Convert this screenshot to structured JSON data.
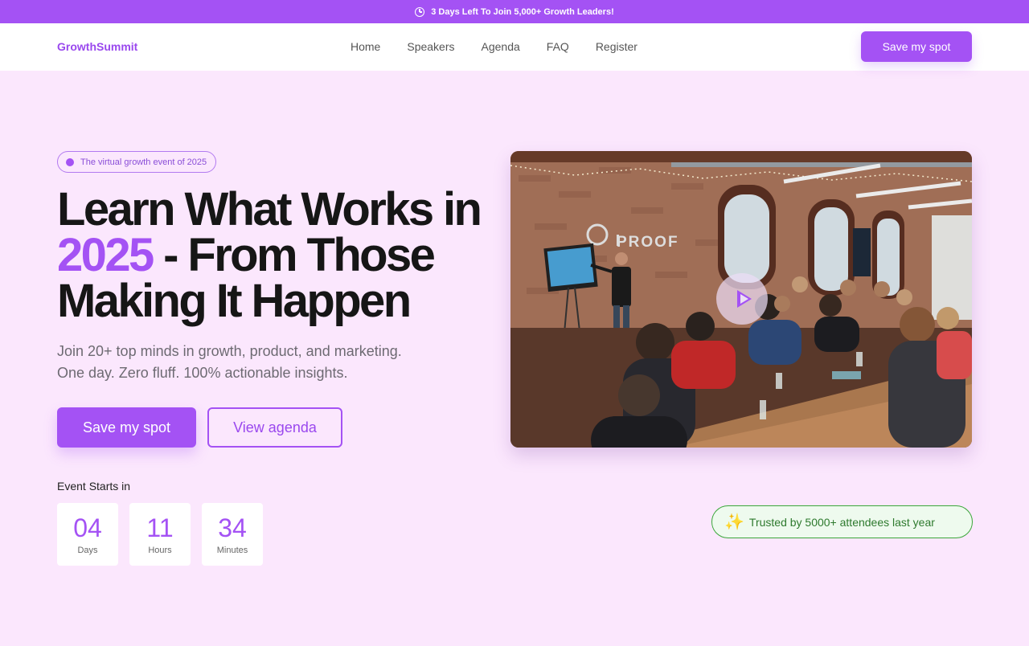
{
  "announcement": {
    "icon": "clock-icon",
    "text": "3 Days Left To Join 5,000+ Growth Leaders!"
  },
  "nav": {
    "logo": "GrowthSummit",
    "links": [
      "Home",
      "Speakers",
      "Agenda",
      "FAQ",
      "Register"
    ],
    "cta": "Save my spot"
  },
  "hero": {
    "badge": "The virtual growth event of 2025",
    "headline": {
      "line1": "Learn What Works in",
      "accent": "2025",
      "line2_rest": " - From Those",
      "line3": "Making It Happen"
    },
    "subtitle_line1": "Join 20+ top minds in growth, product, and marketing.",
    "subtitle_line2": "One day. Zero fluff. 100% actionable insights.",
    "primary_button": "Save my spot",
    "secondary_button": "View agenda"
  },
  "countdown": {
    "label": "Event Starts in",
    "units": [
      {
        "value": "04",
        "label": "Days"
      },
      {
        "value": "11",
        "label": "Hours"
      },
      {
        "value": "34",
        "label": "Minutes"
      }
    ]
  },
  "video": {
    "sign_text": "PROOF",
    "play_icon": "play-icon"
  },
  "trusted": {
    "icon": "sparkles-icon",
    "emoji": "✨",
    "text": "Trusted by 5000+ attendees last year"
  },
  "colors": {
    "accent": "#a452f4",
    "background": "#fbe7fd",
    "success": "#3aa63a"
  }
}
